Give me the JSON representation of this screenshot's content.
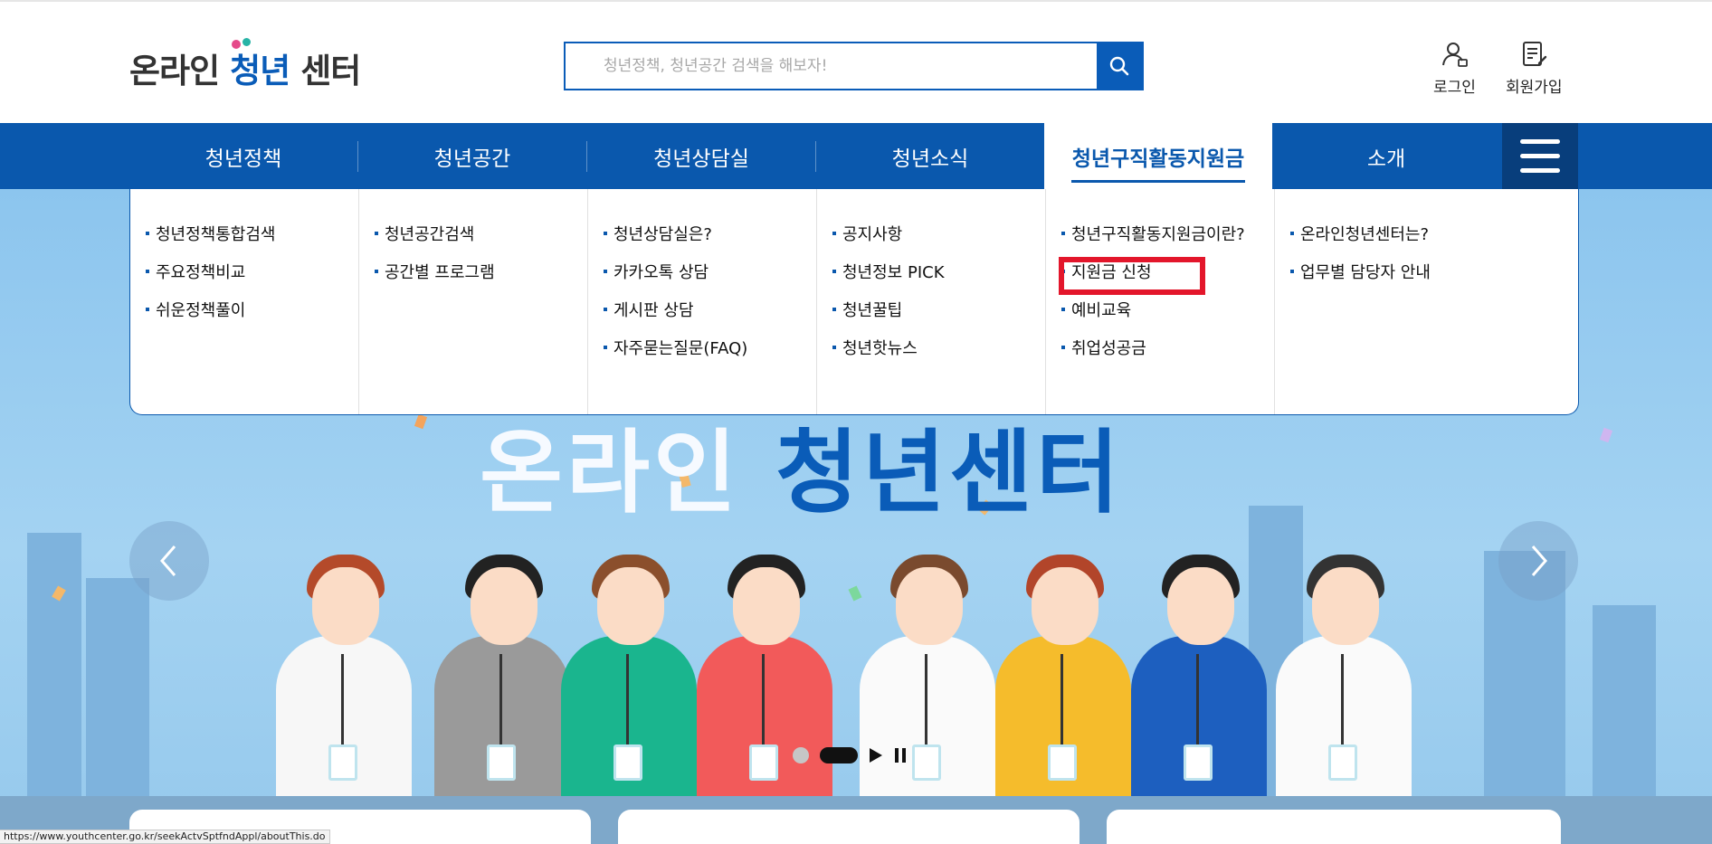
{
  "header": {
    "logo": {
      "prefix": "온라인",
      "accent": "청년",
      "suffix": "센터"
    },
    "search": {
      "placeholder": "청년정책, 청년공간 검색을 해보자!",
      "value": ""
    },
    "login_label": "로그인",
    "join_label": "회원가입"
  },
  "nav": {
    "items": [
      {
        "label": "청년정책"
      },
      {
        "label": "청년공간"
      },
      {
        "label": "청년상담실"
      },
      {
        "label": "청년소식"
      },
      {
        "label": "청년구직활동지원금"
      },
      {
        "label": "소개"
      }
    ],
    "active_index": 4
  },
  "dropdown": {
    "columns": [
      {
        "links": [
          "청년정책통합검색",
          "주요정책비교",
          "쉬운정책풀이"
        ]
      },
      {
        "links": [
          "청년공간검색",
          "공간별 프로그램"
        ]
      },
      {
        "links": [
          "청년상담실은?",
          "카카오톡 상담",
          "게시판 상담",
          "자주묻는질문(FAQ)"
        ]
      },
      {
        "links": [
          "공지사항",
          "청년정보 PICK",
          "청년꿀팁",
          "청년핫뉴스"
        ]
      },
      {
        "links": [
          "청년구직활동지원금이란?",
          "지원금 신청",
          "예비교육",
          "취업성공금"
        ]
      },
      {
        "links": [
          "온라인청년센터는?",
          "업무별 담당자 안내"
        ]
      }
    ],
    "highlighted": "지원금 신청"
  },
  "hero": {
    "title_left": "온라인",
    "title_right": "청년센터"
  },
  "status_url": "https://www.youthcenter.go.kr/seekActvSptfndAppl/aboutThis.do",
  "colors": {
    "primary": "#0a58ad",
    "primary_dark": "#083e7c",
    "highlight_box": "#e3162b",
    "hero_bg": "#a4d3f2"
  },
  "icons": {
    "search": "magnifier-icon",
    "login": "user-icon",
    "join": "document-edit-icon",
    "menu": "hamburger-icon",
    "prev": "chevron-left-icon",
    "next": "chevron-right-icon",
    "play": "play-icon",
    "pause": "pause-icon"
  }
}
